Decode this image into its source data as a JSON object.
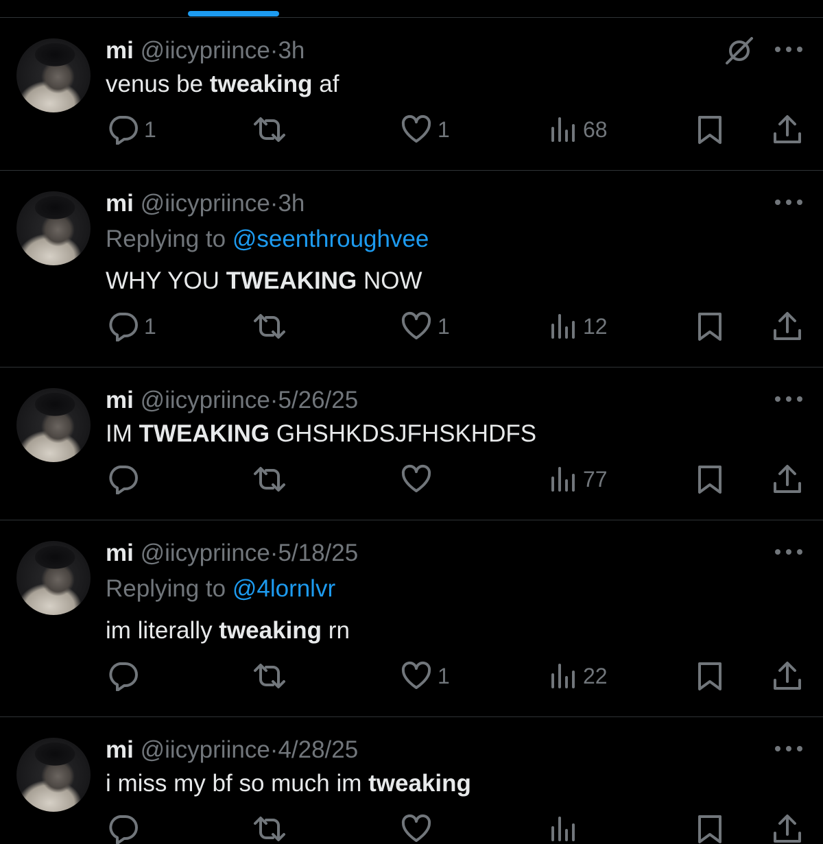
{
  "colors": {
    "background": "#000000",
    "accent": "#1d9bf0",
    "muted": "#71767b",
    "text": "#e7e9ea",
    "divider": "#2f3336"
  },
  "tweets": [
    {
      "name": "mi",
      "handle": "@iicypriince",
      "dot": "·",
      "time": "3h",
      "has_grok": true,
      "replying_prefix": "",
      "replying_to": "",
      "text_before": "venus be ",
      "text_bold": "tweaking",
      "text_after": " af",
      "replies": "1",
      "retweets": "",
      "likes": "1",
      "views": "68"
    },
    {
      "name": "mi",
      "handle": "@iicypriince",
      "dot": "·",
      "time": "3h",
      "has_grok": false,
      "replying_prefix": "Replying to ",
      "replying_to": "@seenthroughvee",
      "text_before": "WHY YOU ",
      "text_bold": "TWEAKING",
      "text_after": " NOW",
      "replies": "1",
      "retweets": "",
      "likes": "1",
      "views": "12"
    },
    {
      "name": "mi",
      "handle": "@iicypriince",
      "dot": "·",
      "time": "5/26/25",
      "has_grok": false,
      "replying_prefix": "",
      "replying_to": "",
      "text_before": "IM ",
      "text_bold": "TWEAKING",
      "text_after": " GHSHKDSJFHSKHDFS",
      "replies": "",
      "retweets": "",
      "likes": "",
      "views": "77"
    },
    {
      "name": "mi",
      "handle": "@iicypriince",
      "dot": "·",
      "time": "5/18/25",
      "has_grok": false,
      "replying_prefix": "Replying to ",
      "replying_to": "@4lornlvr",
      "text_before": "im literally ",
      "text_bold": "tweaking",
      "text_after": " rn",
      "replies": "",
      "retweets": "",
      "likes": "1",
      "views": "22"
    },
    {
      "name": "mi",
      "handle": "@iicypriince",
      "dot": "·",
      "time": "4/28/25",
      "has_grok": false,
      "replying_prefix": "",
      "replying_to": "",
      "text_before": "i miss my bf so much im ",
      "text_bold": "tweaking",
      "text_after": "",
      "replies": "",
      "retweets": "",
      "likes": "",
      "views": ""
    }
  ]
}
